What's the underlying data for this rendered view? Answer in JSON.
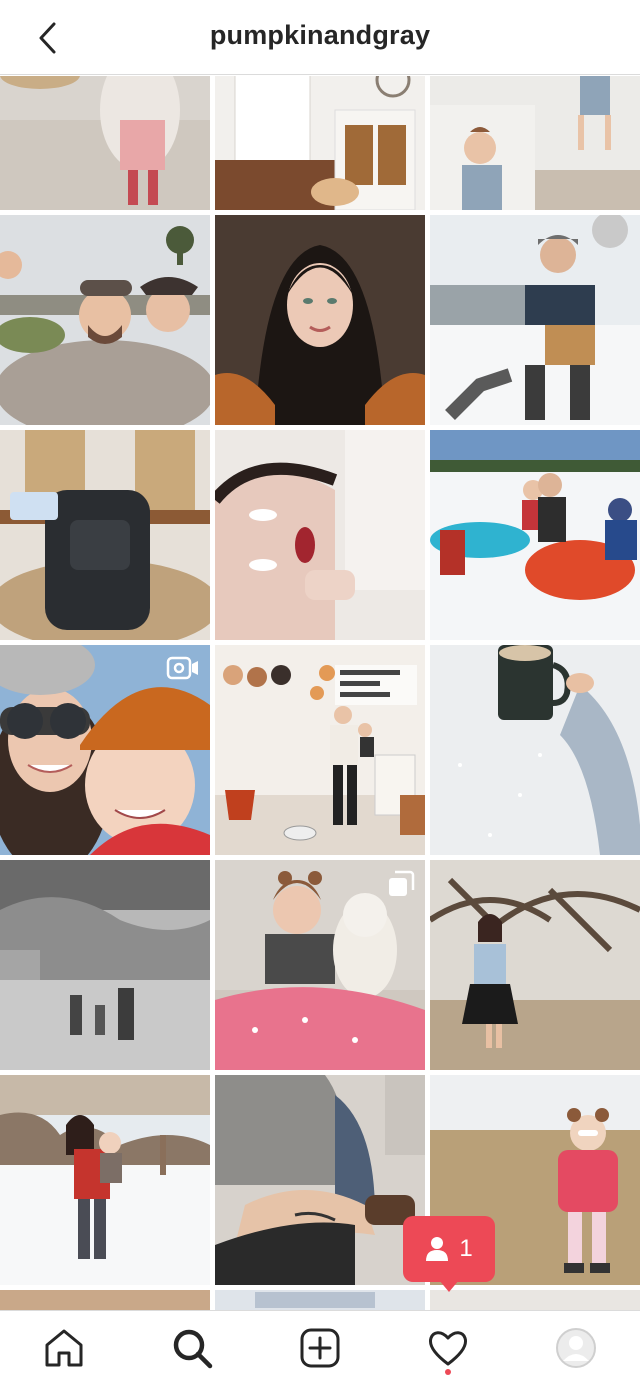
{
  "header": {
    "username": "pumpkinandgray",
    "back_icon": "chevron-left-icon"
  },
  "grid": {
    "rows": 6,
    "columns": 3,
    "posts": [
      {
        "index": 1,
        "type": "photo"
      },
      {
        "index": 2,
        "type": "photo"
      },
      {
        "index": 3,
        "type": "photo"
      },
      {
        "index": 4,
        "type": "photo"
      },
      {
        "index": 5,
        "type": "photo"
      },
      {
        "index": 6,
        "type": "photo"
      },
      {
        "index": 7,
        "type": "photo"
      },
      {
        "index": 8,
        "type": "photo"
      },
      {
        "index": 9,
        "type": "photo"
      },
      {
        "index": 10,
        "type": "igtv",
        "badge_icon": "igtv-icon"
      },
      {
        "index": 11,
        "type": "photo"
      },
      {
        "index": 12,
        "type": "photo"
      },
      {
        "index": 13,
        "type": "photo"
      },
      {
        "index": 14,
        "type": "carousel",
        "badge_icon": "carousel-icon"
      },
      {
        "index": 15,
        "type": "photo"
      },
      {
        "index": 16,
        "type": "photo"
      },
      {
        "index": 17,
        "type": "photo"
      },
      {
        "index": 18,
        "type": "photo"
      }
    ]
  },
  "notification_toast": {
    "icon": "person-icon",
    "count": "1"
  },
  "tab_bar": {
    "items": [
      "home-icon",
      "search-icon",
      "new-post-icon",
      "activity-heart-icon",
      "profile-avatar-icon"
    ],
    "active": "search-icon"
  },
  "colors": {
    "accent_red": "#ed4956",
    "text": "#262626",
    "border": "#dbdbdb"
  }
}
